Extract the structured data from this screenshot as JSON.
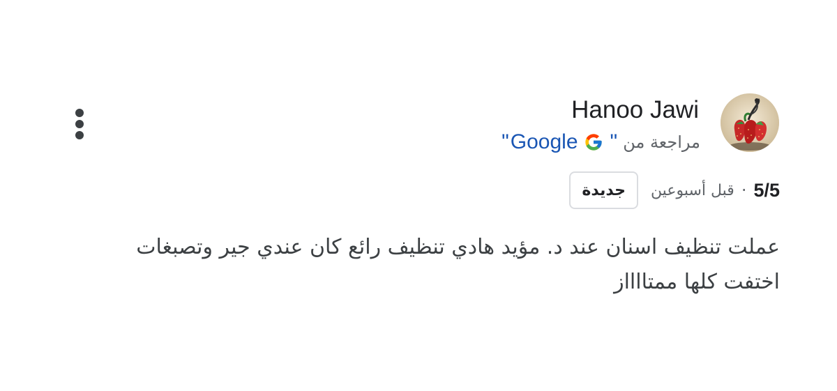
{
  "reviewer": {
    "name": "Hanoo Jawi",
    "avatar_icon": "strawberry-photo-avatar"
  },
  "source": {
    "prefix": "مراجعة من",
    "open_quote": "\"",
    "logo_icon": "google-g-icon",
    "name": "Google",
    "close_quote": "\""
  },
  "menu": {
    "icon": "more-vert-icon"
  },
  "meta": {
    "rating": "5/5",
    "separator": "·",
    "time": "قبل أسبوعين",
    "badge": "جديدة"
  },
  "review": {
    "text": "عملت تنظيف اسنان عند د. مؤيد هادي تنظيف رائع كان عندي جير وتصبغات اختفت كلها ممتااااز"
  },
  "colors": {
    "link_blue": "#1a56b4",
    "text_primary": "#202124",
    "text_secondary": "#5f6368",
    "badge_border": "#dadce0",
    "google_blue": "#4285F4",
    "google_red": "#EA4335",
    "google_yellow": "#FBBC05",
    "google_green": "#34A853"
  }
}
